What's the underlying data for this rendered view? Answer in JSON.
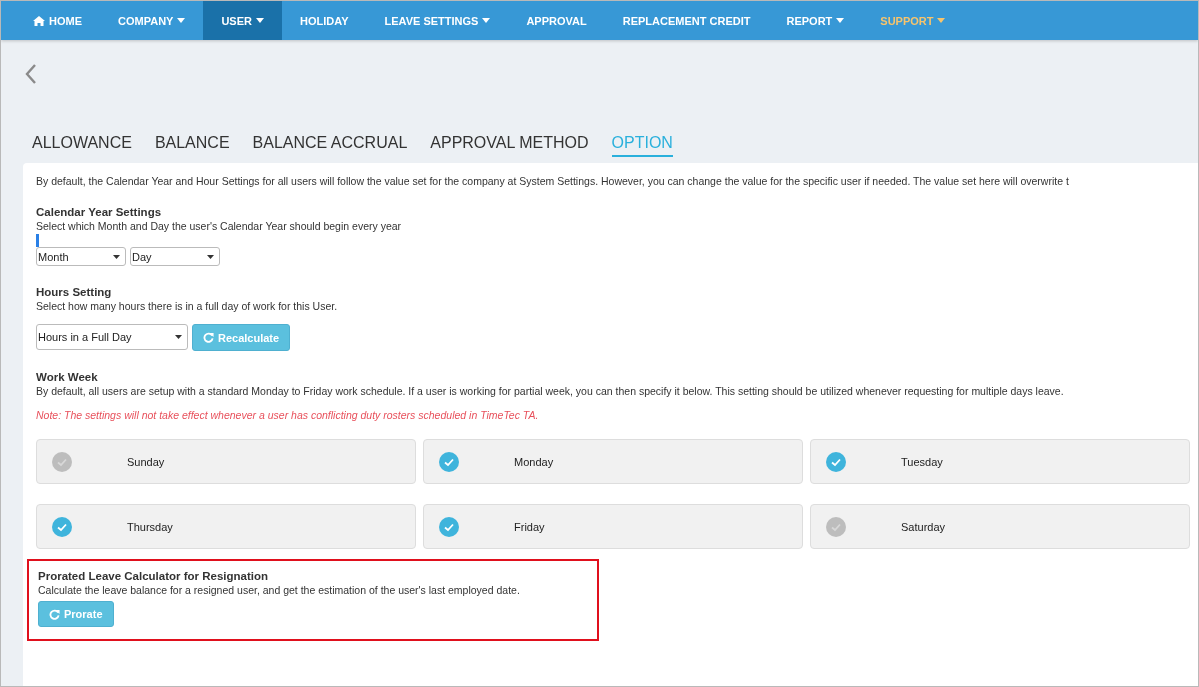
{
  "nav": [
    {
      "label": "HOME",
      "kind": "home",
      "dropdown": false,
      "selected": false
    },
    {
      "label": "COMPANY",
      "kind": "plain",
      "dropdown": true,
      "selected": false
    },
    {
      "label": "USER",
      "kind": "plain",
      "dropdown": true,
      "selected": true
    },
    {
      "label": "HOLIDAY",
      "kind": "plain",
      "dropdown": false,
      "selected": false
    },
    {
      "label": "LEAVE SETTINGS",
      "kind": "plain",
      "dropdown": true,
      "selected": false
    },
    {
      "label": "APPROVAL",
      "kind": "plain",
      "dropdown": false,
      "selected": false
    },
    {
      "label": "REPLACEMENT CREDIT",
      "kind": "plain",
      "dropdown": false,
      "selected": false
    },
    {
      "label": "REPORT",
      "kind": "plain",
      "dropdown": true,
      "selected": false
    },
    {
      "label": "SUPPORT",
      "kind": "accent",
      "dropdown": true,
      "selected": false
    }
  ],
  "tabs": [
    {
      "label": "ALLOWANCE",
      "selected": false
    },
    {
      "label": "BALANCE",
      "selected": false
    },
    {
      "label": "BALANCE ACCRUAL",
      "selected": false
    },
    {
      "label": "APPROVAL METHOD",
      "selected": false
    },
    {
      "label": "OPTION",
      "selected": true
    }
  ],
  "intro": "By default, the Calendar Year and Hour Settings for all users will follow the value set for the company at System Settings. However, you can change the value for the specific user if needed. The value set here will overwrite t",
  "calendar": {
    "title": "Calendar Year Settings",
    "description": "Select which Month and Day the user's Calendar Year should begin every year",
    "month": "Month",
    "day": "Day"
  },
  "hours": {
    "title": "Hours Setting",
    "description": "Select how many hours there is in a full day of work for this User.",
    "select": "Hours in a Full Day",
    "button": "Recalculate"
  },
  "work_week": {
    "title": "Work Week",
    "description": "By default, all users are setup with a standard Monday to Friday work schedule. If a user is working for partial week, you can then specify it below. This setting should be utilized whenever requesting for multiple days leave.",
    "note": "Note: The settings will not take effect whenever a user has conflicting duty rosters scheduled in TimeTec TA.",
    "days": [
      {
        "label": "Sunday",
        "checked": false
      },
      {
        "label": "Monday",
        "checked": true
      },
      {
        "label": "Tuesday",
        "checked": true
      },
      {
        "label": "Thursday",
        "checked": true
      },
      {
        "label": "Friday",
        "checked": true
      },
      {
        "label": "Saturday",
        "checked": false
      }
    ]
  },
  "prorate": {
    "title": "Prorated Leave Calculator for Resignation",
    "description": "Calculate the leave balance for a resigned user, and get the estimation of the user's last employed date.",
    "button": "Prorate"
  }
}
